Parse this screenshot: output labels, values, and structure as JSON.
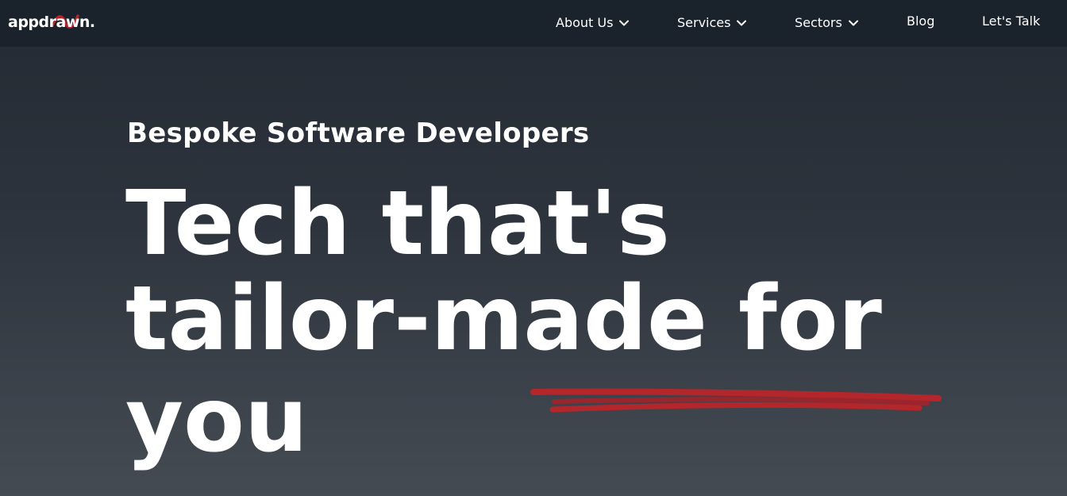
{
  "brand": {
    "name": "appdrawn.",
    "accent_color": "#b3262b"
  },
  "nav": {
    "items": [
      {
        "label": "About Us",
        "has_dropdown": true,
        "icon": "chevron-down-icon"
      },
      {
        "label": "Services",
        "has_dropdown": true,
        "icon": "chevron-down-icon"
      },
      {
        "label": "Sectors",
        "has_dropdown": true,
        "icon": "chevron-down-icon"
      },
      {
        "label": "Blog",
        "has_dropdown": false
      },
      {
        "label": "Let's Talk",
        "has_dropdown": false
      }
    ]
  },
  "hero": {
    "subtitle": "Bespoke Software Developers",
    "headline_lines": [
      "Tech that's",
      "tailor-made for",
      "you"
    ]
  }
}
